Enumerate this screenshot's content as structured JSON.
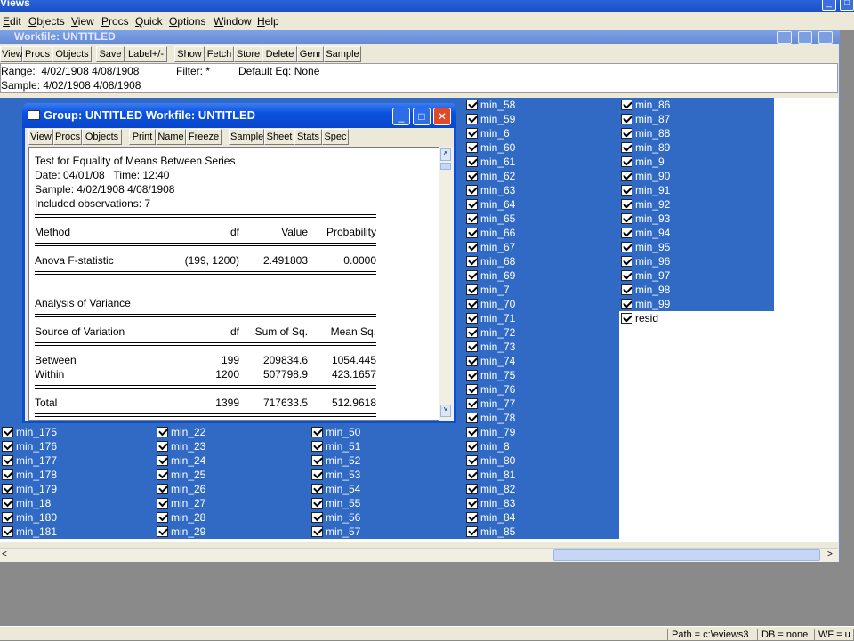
{
  "app": {
    "title": "Views"
  },
  "menu": [
    {
      "first": "E",
      "rest": "dit"
    },
    {
      "first": "O",
      "rest": "bjects"
    },
    {
      "first": "V",
      "rest": "iew"
    },
    {
      "first": "P",
      "rest": "rocs"
    },
    {
      "first": "Q",
      "rest": "uick"
    },
    {
      "first": "O",
      "rest": "ptions"
    },
    {
      "first": "W",
      "rest": "indow"
    },
    {
      "first": "H",
      "rest": "elp"
    }
  ],
  "workfile": {
    "title": "Workfile: UNTITLED",
    "toolbar": [
      "View",
      "Procs",
      "Objects",
      "Save",
      "Label+/-",
      "Show",
      "Fetch",
      "Store",
      "Delete",
      "Genr",
      "Sample"
    ],
    "range_label": "Range:  4/02/1908 4/08/1908",
    "filter_label": "Filter: *",
    "default_eq_label": "Default Eq: None",
    "sample_label": "Sample: 4/02/1908 4/08/1908"
  },
  "series_columns": [
    [
      "min_175",
      "min_176",
      "min_177",
      "min_178",
      "min_179",
      "min_18",
      "min_180",
      "min_181"
    ],
    [
      "min_22",
      "min_23",
      "min_24",
      "min_25",
      "min_26",
      "min_27",
      "min_28",
      "min_29"
    ],
    [
      "min_50",
      "min_51",
      "min_52",
      "min_53",
      "min_54",
      "min_55",
      "min_56",
      "min_57"
    ],
    [
      "min_58",
      "min_59",
      "min_6",
      "min_60",
      "min_61",
      "min_62",
      "min_63",
      "min_64",
      "min_65",
      "min_66",
      "min_67",
      "min_68",
      "min_69",
      "min_7",
      "min_70",
      "min_71",
      "min_72",
      "min_73",
      "min_74",
      "min_75",
      "min_76",
      "min_77",
      "min_78",
      "min_79",
      "min_8",
      "min_80",
      "min_81",
      "min_82",
      "min_83",
      "min_84",
      "min_85"
    ],
    [
      "min_86",
      "min_87",
      "min_88",
      "min_89",
      "min_9",
      "min_90",
      "min_91",
      "min_92",
      "min_93",
      "min_94",
      "min_95",
      "min_96",
      "min_97",
      "min_98",
      "min_99"
    ]
  ],
  "resid_label": "resid",
  "group": {
    "title": "Group: UNTITLED   Workfile: UNTITLED",
    "toolbar": [
      "View",
      "Procs",
      "Objects",
      "Print",
      "Name",
      "Freeze",
      "Sample",
      "Sheet",
      "Stats",
      "Spec"
    ],
    "output": {
      "heading": "Test for Equality of Means Between Series",
      "date": "Date: 04/01/08   Time: 12:40",
      "sample": "Sample: 4/02/1908 4/08/1908",
      "obs": "Included observations: 7",
      "t1_headers": [
        "Method",
        "df",
        "Value",
        "Probability"
      ],
      "t1_row": [
        "Anova F-statistic",
        "(199, 1200)",
        "2.491803",
        "0.0000"
      ],
      "aov_heading": "Analysis of Variance",
      "t2_headers": [
        "Source of Variation",
        "df",
        "Sum of Sq.",
        "Mean Sq."
      ],
      "t2_rows": [
        [
          "Between",
          "199",
          "209834.6",
          "1054.445"
        ],
        [
          "Within",
          "1200",
          "507798.9",
          "423.1657"
        ]
      ],
      "t2_total": [
        "Total",
        "1399",
        "717633.5",
        "512.9618"
      ]
    }
  },
  "status": [
    "Path = c:\\eviews3",
    "DB = none",
    "WF = u"
  ]
}
